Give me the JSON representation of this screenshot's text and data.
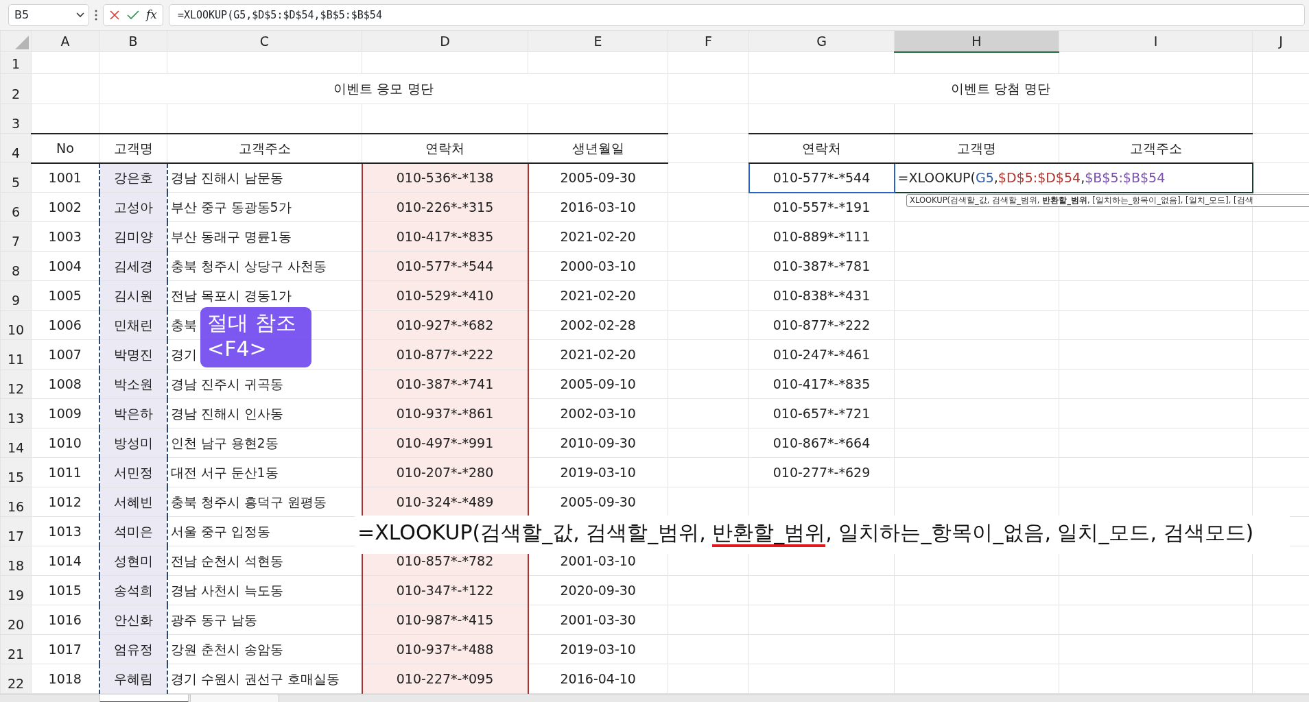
{
  "name_box": "B5",
  "function_button": "fx",
  "formula_bar": "=XLOOKUP(G5,$D$5:$D$54,$B$5:$B$54",
  "columns": [
    {
      "label": "A",
      "selected": false
    },
    {
      "label": "B",
      "selected": false
    },
    {
      "label": "C",
      "selected": false
    },
    {
      "label": "D",
      "selected": false
    },
    {
      "label": "E",
      "selected": false
    },
    {
      "label": "F",
      "selected": false
    },
    {
      "label": "G",
      "selected": false
    },
    {
      "label": "H",
      "selected": true
    },
    {
      "label": "I",
      "selected": false
    },
    {
      "label": "J",
      "selected": false
    }
  ],
  "row_numbers": [
    "1",
    "2",
    "3",
    "4",
    "5",
    "6",
    "7",
    "8",
    "9",
    "10",
    "11",
    "12",
    "13",
    "14",
    "15",
    "16",
    "17",
    "18",
    "19",
    "20",
    "21",
    "22"
  ],
  "entry_table": {
    "title": "이벤트 응모 명단",
    "headers": [
      "No",
      "고객명",
      "고객주소",
      "연락처",
      "생년월일"
    ],
    "rows": [
      [
        "1001",
        "강은호",
        "경남 진해시 남문동",
        "010-536*-*138",
        "2005-09-30"
      ],
      [
        "1002",
        "고성아",
        "부산 중구 동광동5가",
        "010-226*-*315",
        "2016-03-10"
      ],
      [
        "1003",
        "김미양",
        "부산 동래구 명륜1동",
        "010-417*-*835",
        "2021-02-20"
      ],
      [
        "1004",
        "김세경",
        "충북 청주시 상당구 사천동",
        "010-577*-*544",
        "2000-03-10"
      ],
      [
        "1005",
        "김시원",
        "전남 목포시 경동1가",
        "010-529*-*410",
        "2021-02-20"
      ],
      [
        "1006",
        "민채린",
        "충북",
        "010-927*-*682",
        "2002-02-28"
      ],
      [
        "1007",
        "박명진",
        "경기",
        "010-877*-*222",
        "2021-02-20"
      ],
      [
        "1008",
        "박소원",
        "경남 진주시 귀곡동",
        "010-387*-*741",
        "2005-09-10"
      ],
      [
        "1009",
        "박은하",
        "경남 진해시 인사동",
        "010-937*-*861",
        "2002-03-10"
      ],
      [
        "1010",
        "방성미",
        "인천 남구 용현2동",
        "010-497*-*991",
        "2010-09-30"
      ],
      [
        "1011",
        "서민정",
        "대전 서구 둔산1동",
        "010-207*-*280",
        "2019-03-10"
      ],
      [
        "1012",
        "서혜빈",
        "충북 청주시 흥덕구 원평동",
        "010-324*-*489",
        "2005-09-30"
      ],
      [
        "1013",
        "석미은",
        "서울 중구 입정동"
      ],
      [
        "1014",
        "성현미",
        "전남 순천시 석현동",
        "010-857*-*782",
        "2001-03-10"
      ],
      [
        "1015",
        "송석희",
        "경남 사천시 늑도동",
        "010-347*-*122",
        "2020-09-30"
      ],
      [
        "1016",
        "안신화",
        "광주 동구 남동",
        "010-987*-*415",
        "2001-03-30"
      ],
      [
        "1017",
        "엄유정",
        "강원 춘천시 송암동",
        "010-937*-*488",
        "2019-03-10"
      ],
      [
        "1018",
        "우혜림",
        "경기 수원시 권선구 호매실동",
        "010-227*-*095",
        "2016-04-10"
      ]
    ]
  },
  "winner_table": {
    "title": "이벤트 당첨 명단",
    "headers": [
      "연락처",
      "고객명",
      "고객주소"
    ],
    "contacts": [
      "010-577*-*544",
      "010-557*-*191",
      "010-889*-*111",
      "010-387*-*781",
      "010-838*-*431",
      "010-877*-*222",
      "010-247*-*461",
      "010-417*-*835",
      "010-657*-*721",
      "010-867*-*664",
      "010-277*-*629"
    ]
  },
  "cell_formula": [
    {
      "text": "=XLOOKUP(",
      "color": "#222222"
    },
    {
      "text": "G5",
      "color": "#2f5fa8"
    },
    {
      "text": ",",
      "color": "#222222"
    },
    {
      "text": "$D$5:$D$54",
      "color": "#b0352e"
    },
    {
      "text": ",",
      "color": "#222222"
    },
    {
      "text": "$B$5:$B$54",
      "color": "#7a50b0"
    }
  ],
  "function_tooltip": "XLOOKUP(검색할_값, 검색할_범위, **반환할_범위**, [일치하는_항목이_없음], [일치_모드], [검색",
  "shortcut_badge": [
    "절대 참조",
    "<F4>"
  ],
  "syntax_caption": [
    {
      "text": "=XLOOKUP(검색할_값, 검색할_범위, ",
      "underlined": false
    },
    {
      "text": "반환할_범위",
      "underlined": true
    },
    {
      "text": ", 일치하는_항목이_없음, 일치_모드, 검색모드)",
      "underlined": false
    }
  ],
  "sheet_tabs": [
    {
      "selected": true
    },
    {
      "selected": false
    }
  ]
}
